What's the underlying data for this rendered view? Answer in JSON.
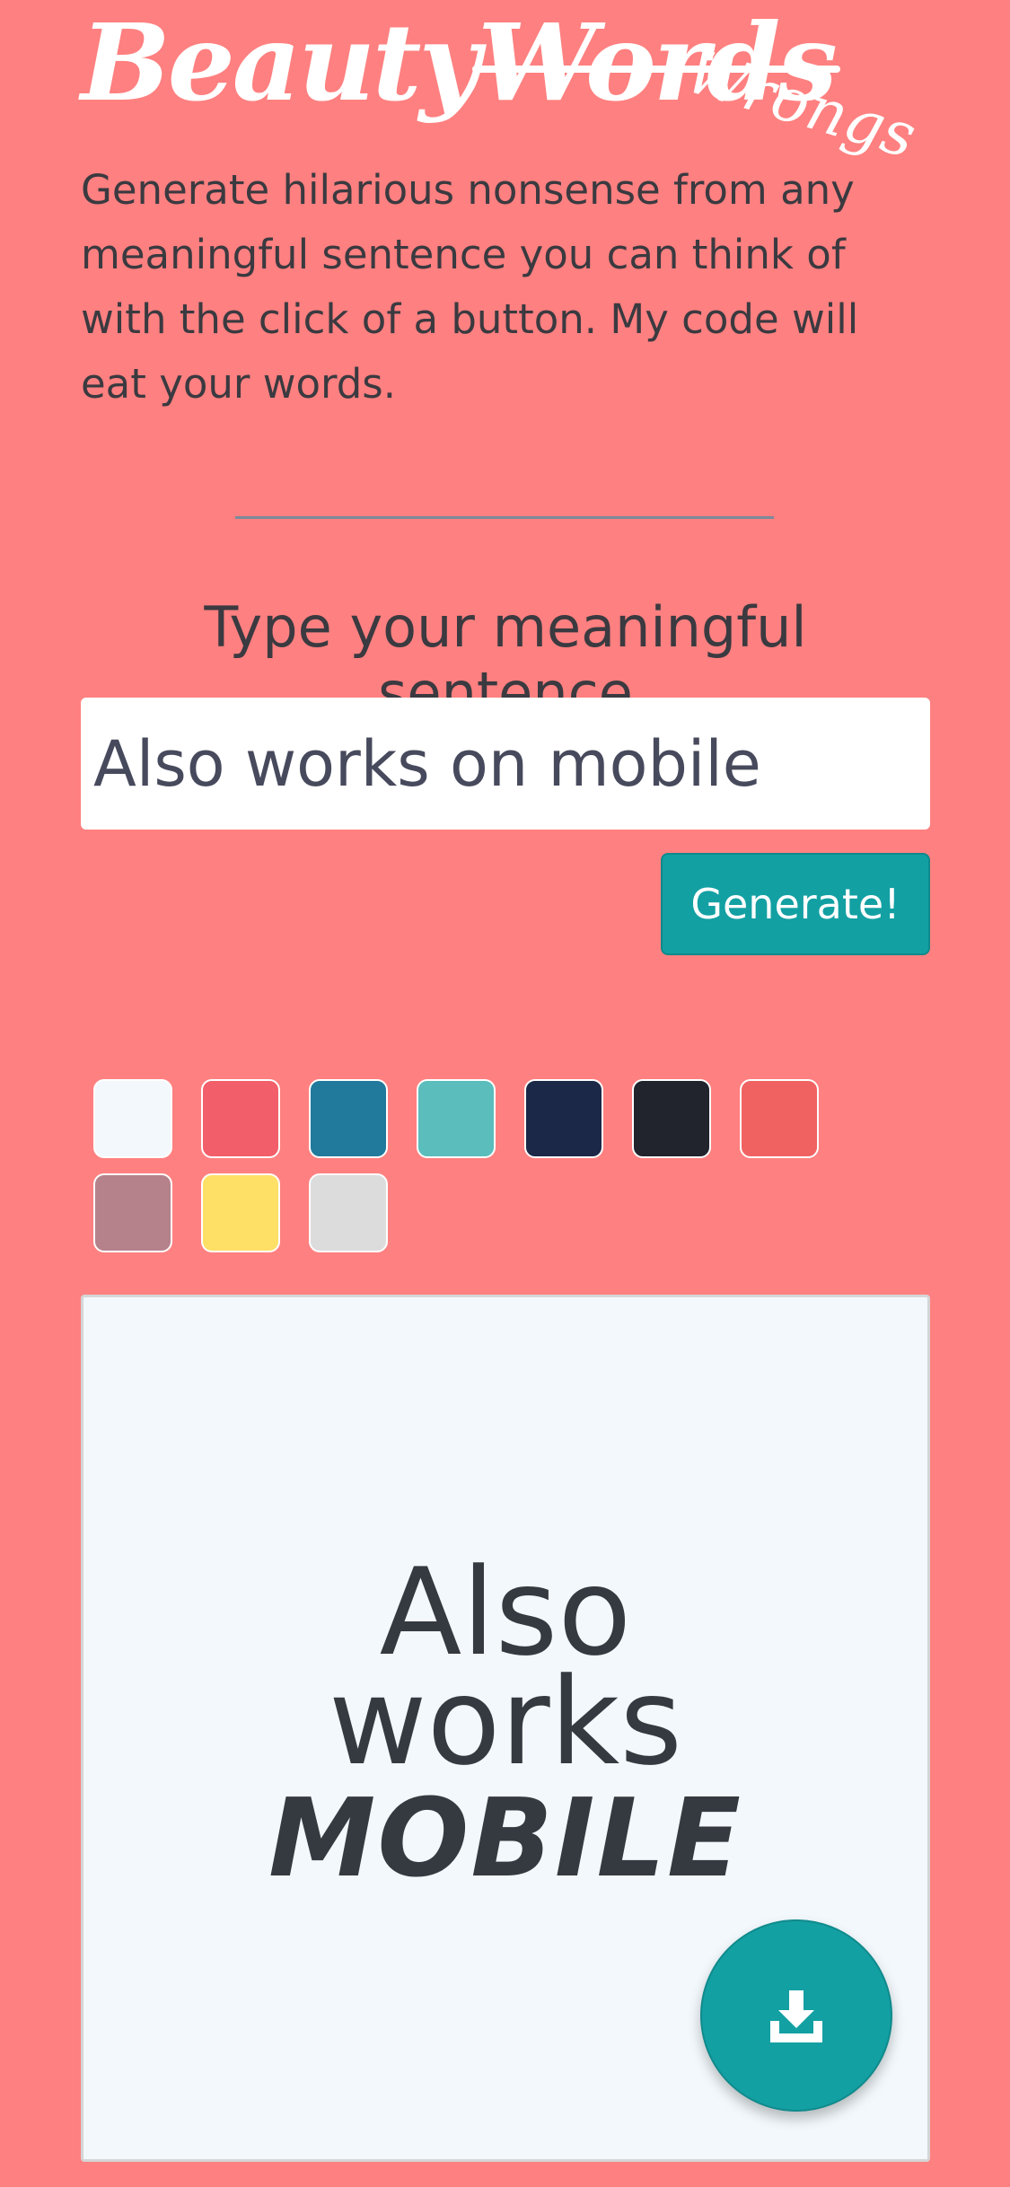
{
  "logo": {
    "word1": "Beauty",
    "word2": "Words",
    "word3": "Wrongs"
  },
  "intro": {
    "text": "Generate hilarious nonsense from any meaningful sentence you can think of with the click of a button. My code will eat your words."
  },
  "form": {
    "label": "Type your meaningful sentence",
    "input_value": "Also works on mobile",
    "generate_label": "Generate!"
  },
  "palette": {
    "colors": [
      "#F2F8FC",
      "#F25F6A",
      "#217A9C",
      "#5BBDBC",
      "#1B2847",
      "#21232D",
      "#F06262",
      "#B5828B",
      "#FFE066",
      "#DCDCDC"
    ]
  },
  "preview": {
    "line1": "Also",
    "line2": "works",
    "line3": "MOBILE"
  },
  "download": {
    "icon": "download-icon"
  },
  "colors": {
    "background": "#FF8080",
    "accent": "#13A0A3",
    "card": "#F2F8FC"
  }
}
